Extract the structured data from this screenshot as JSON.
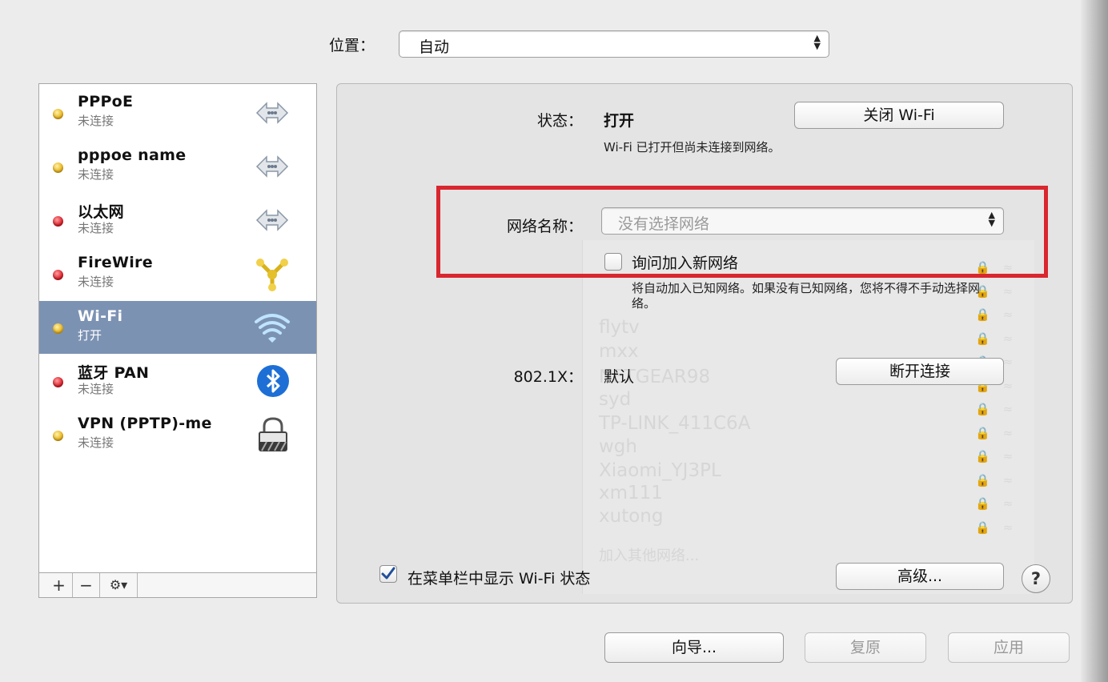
{
  "location": {
    "label": "位置：",
    "value": "自动"
  },
  "services": [
    {
      "name": "PPPoE",
      "status": "未连接",
      "dot": "yellow",
      "icon": "pppoe-arrows-icon"
    },
    {
      "name": "pppoe name",
      "status": "未连接",
      "dot": "yellow",
      "icon": "pppoe-arrows-icon"
    },
    {
      "name": "以太网",
      "status": "未连接",
      "dot": "red",
      "icon": "ethernet-arrows-icon"
    },
    {
      "name": "FireWire",
      "status": "未连接",
      "dot": "red",
      "icon": "firewire-icon"
    },
    {
      "name": "Wi-Fi",
      "status": "打开",
      "dot": "yellow",
      "icon": "wifi-icon",
      "selected": true
    },
    {
      "name": "蓝牙 PAN",
      "status": "未连接",
      "dot": "red",
      "icon": "bluetooth-icon"
    },
    {
      "name": "VPN (PPTP)-me",
      "status": "未连接",
      "dot": "yellow",
      "icon": "lock-icon"
    }
  ],
  "toolbar": {
    "add": "+",
    "remove": "−",
    "gear": "⚙▾"
  },
  "detail": {
    "status_label": "状态：",
    "status_value": "打开",
    "toggle_wifi": "关闭 Wi-Fi",
    "status_note": "Wi-Fi 已打开但尚未连接到网络。",
    "network_label": "网络名称：",
    "network_placeholder": "没有选择网络",
    "ask_join_label": "询问加入新网络",
    "ask_join_note": "将自动加入已知网络。如果没有已知网络，您将不得不手动选择网络。",
    "dot1x_label": "802.1X：",
    "dot1x_value": "默认",
    "disconnect": "断开连接",
    "show_menu_label": "在菜单栏中显示 Wi-Fi 状态",
    "advanced": "高级...",
    "help": "?"
  },
  "background_networks": [
    "flytv",
    "mxx",
    "NETGEAR98",
    "syd",
    "TP-LINK_411C6A",
    "wgh",
    "Xiaomi_YJ3PL",
    "xm111",
    "xutong"
  ],
  "background_join_other": "加入其他网络...",
  "footer": {
    "assistant": "向导...",
    "revert": "复原",
    "apply": "应用"
  },
  "colors": {
    "selected_row": "#7c92b3",
    "highlight_box": "#d9262f",
    "status_red": "#d8202a",
    "status_yellow": "#e7b21b"
  }
}
